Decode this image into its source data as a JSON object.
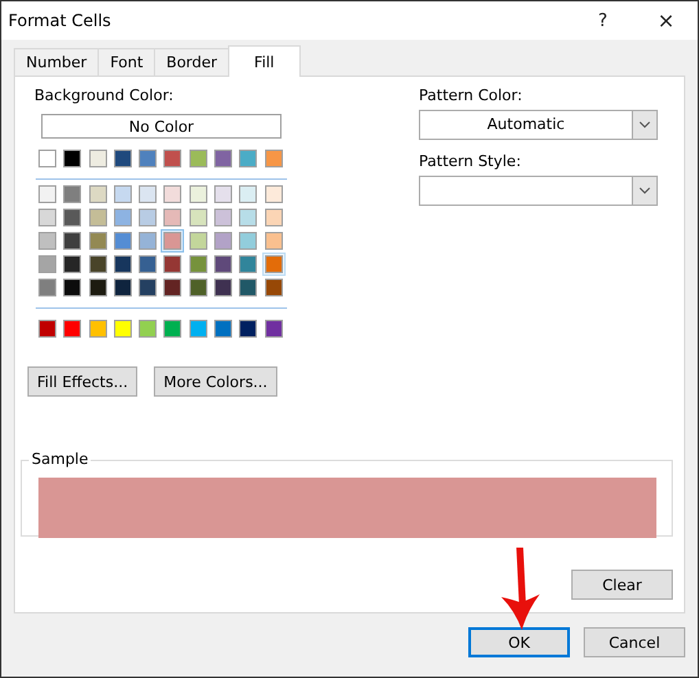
{
  "window": {
    "title": "Format Cells",
    "help": "?",
    "close": "×"
  },
  "tabs": [
    {
      "label": "Number",
      "selected": false
    },
    {
      "label": "Font",
      "selected": false
    },
    {
      "label": "Border",
      "selected": false
    },
    {
      "label": "Fill",
      "selected": true
    }
  ],
  "background_color": {
    "label": "Background Color:",
    "no_color_button": "No Color",
    "swatch_rows": [
      {
        "kind": "theme",
        "swatches": [
          {
            "color": "#ffffff",
            "selected": false,
            "hovered": false
          },
          {
            "color": "#000000",
            "selected": false,
            "hovered": false
          },
          {
            "color": "#eeece1",
            "selected": false,
            "hovered": false
          },
          {
            "color": "#1f497d",
            "selected": false,
            "hovered": false
          },
          {
            "color": "#4f81bd",
            "selected": false,
            "hovered": false
          },
          {
            "color": "#c0504d",
            "selected": false,
            "hovered": false
          },
          {
            "color": "#9bbb59",
            "selected": false,
            "hovered": false
          },
          {
            "color": "#8064a2",
            "selected": false,
            "hovered": false
          },
          {
            "color": "#4bacc6",
            "selected": false,
            "hovered": false
          },
          {
            "color": "#f79646",
            "selected": false,
            "hovered": false
          }
        ]
      },
      {
        "kind": "tint",
        "swatches": [
          {
            "color": "#f2f2f2",
            "selected": false,
            "hovered": false
          },
          {
            "color": "#7f7f7f",
            "selected": false,
            "hovered": false
          },
          {
            "color": "#ddd9c3",
            "selected": false,
            "hovered": false
          },
          {
            "color": "#c6d9f0",
            "selected": false,
            "hovered": false
          },
          {
            "color": "#dbe5f1",
            "selected": false,
            "hovered": false
          },
          {
            "color": "#f2dcdb",
            "selected": false,
            "hovered": false
          },
          {
            "color": "#ebf1dd",
            "selected": false,
            "hovered": false
          },
          {
            "color": "#e5e0ec",
            "selected": false,
            "hovered": false
          },
          {
            "color": "#dbeef3",
            "selected": false,
            "hovered": false
          },
          {
            "color": "#fdeada",
            "selected": false,
            "hovered": false
          }
        ]
      },
      {
        "kind": "tint",
        "swatches": [
          {
            "color": "#d8d8d8",
            "selected": false,
            "hovered": false
          },
          {
            "color": "#595959",
            "selected": false,
            "hovered": false
          },
          {
            "color": "#c4bd97",
            "selected": false,
            "hovered": false
          },
          {
            "color": "#8db3e2",
            "selected": false,
            "hovered": false
          },
          {
            "color": "#b8cce4",
            "selected": false,
            "hovered": false
          },
          {
            "color": "#e5b9b7",
            "selected": false,
            "hovered": false
          },
          {
            "color": "#d7e3bc",
            "selected": false,
            "hovered": false
          },
          {
            "color": "#ccc1d9",
            "selected": false,
            "hovered": false
          },
          {
            "color": "#b7dde8",
            "selected": false,
            "hovered": false
          },
          {
            "color": "#fbd5b5",
            "selected": false,
            "hovered": false
          }
        ]
      },
      {
        "kind": "tint",
        "swatches": [
          {
            "color": "#bfbfbf",
            "selected": false,
            "hovered": false
          },
          {
            "color": "#3f3f3f",
            "selected": false,
            "hovered": false
          },
          {
            "color": "#938953",
            "selected": false,
            "hovered": false
          },
          {
            "color": "#548dd4",
            "selected": false,
            "hovered": false
          },
          {
            "color": "#95b3d7",
            "selected": false,
            "hovered": false
          },
          {
            "color": "#d99694",
            "selected": true,
            "hovered": false
          },
          {
            "color": "#c3d69b",
            "selected": false,
            "hovered": false
          },
          {
            "color": "#b2a2c7",
            "selected": false,
            "hovered": false
          },
          {
            "color": "#92cddc",
            "selected": false,
            "hovered": false
          },
          {
            "color": "#fac08f",
            "selected": false,
            "hovered": false
          }
        ]
      },
      {
        "kind": "tint",
        "swatches": [
          {
            "color": "#a5a5a5",
            "selected": false,
            "hovered": false
          },
          {
            "color": "#262626",
            "selected": false,
            "hovered": false
          },
          {
            "color": "#494429",
            "selected": false,
            "hovered": false
          },
          {
            "color": "#17365d",
            "selected": false,
            "hovered": false
          },
          {
            "color": "#366092",
            "selected": false,
            "hovered": false
          },
          {
            "color": "#953734",
            "selected": false,
            "hovered": false
          },
          {
            "color": "#76923c",
            "selected": false,
            "hovered": false
          },
          {
            "color": "#5f497a",
            "selected": false,
            "hovered": false
          },
          {
            "color": "#31859b",
            "selected": false,
            "hovered": false
          },
          {
            "color": "#e36c09",
            "selected": false,
            "hovered": true
          }
        ]
      },
      {
        "kind": "tint",
        "swatches": [
          {
            "color": "#7f7f7f",
            "selected": false,
            "hovered": false
          },
          {
            "color": "#0c0c0c",
            "selected": false,
            "hovered": false
          },
          {
            "color": "#1d1b10",
            "selected": false,
            "hovered": false
          },
          {
            "color": "#0f243e",
            "selected": false,
            "hovered": false
          },
          {
            "color": "#244061",
            "selected": false,
            "hovered": false
          },
          {
            "color": "#632423",
            "selected": false,
            "hovered": false
          },
          {
            "color": "#4f6128",
            "selected": false,
            "hovered": false
          },
          {
            "color": "#3f3151",
            "selected": false,
            "hovered": false
          },
          {
            "color": "#205867",
            "selected": false,
            "hovered": false
          },
          {
            "color": "#974806",
            "selected": false,
            "hovered": false
          }
        ]
      },
      {
        "kind": "standard",
        "swatches": [
          {
            "color": "#c00000",
            "selected": false,
            "hovered": false
          },
          {
            "color": "#ff0000",
            "selected": false,
            "hovered": false
          },
          {
            "color": "#ffc000",
            "selected": false,
            "hovered": false
          },
          {
            "color": "#ffff00",
            "selected": false,
            "hovered": false
          },
          {
            "color": "#92d050",
            "selected": false,
            "hovered": false
          },
          {
            "color": "#00b050",
            "selected": false,
            "hovered": false
          },
          {
            "color": "#00b0f0",
            "selected": false,
            "hovered": false
          },
          {
            "color": "#0070c0",
            "selected": false,
            "hovered": false
          },
          {
            "color": "#002060",
            "selected": false,
            "hovered": false
          },
          {
            "color": "#7030a0",
            "selected": false,
            "hovered": false
          }
        ]
      }
    ],
    "buttons": [
      "Fill Effects...",
      "More Colors..."
    ]
  },
  "pattern_color": {
    "label": "Pattern Color:",
    "value": "Automatic"
  },
  "pattern_style": {
    "label": "Pattern Style:"
  },
  "sample": {
    "label": "Sample",
    "color": "#d99694"
  },
  "clear_button": "Clear",
  "footer_buttons": [
    {
      "label": "OK",
      "default": true
    },
    {
      "label": "Cancel",
      "default": false
    }
  ]
}
